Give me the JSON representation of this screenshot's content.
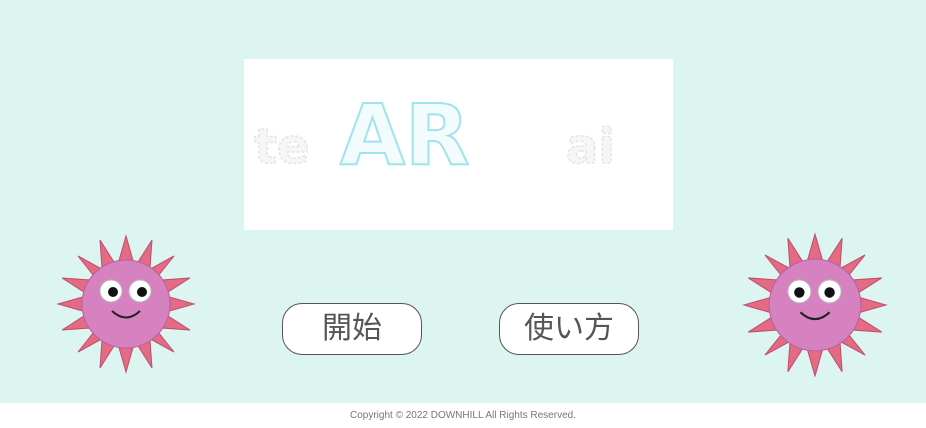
{
  "logo": {
    "prefix": "te",
    "main": "AR",
    "suffix": "ai"
  },
  "buttons": {
    "start_label": "開始",
    "howto_label": "使い方"
  },
  "mascots": {
    "left_icon": "virus-mascot-icon",
    "right_icon": "virus-mascot-icon"
  },
  "colors": {
    "background": "#dcf5f1",
    "virus_spike": "#e36b86",
    "virus_body": "#d682c0",
    "logo_outline": "#9fe3ef"
  },
  "footer": {
    "copyright": "Copyright © 2022 DOWNHILL All Rights Reserved."
  }
}
